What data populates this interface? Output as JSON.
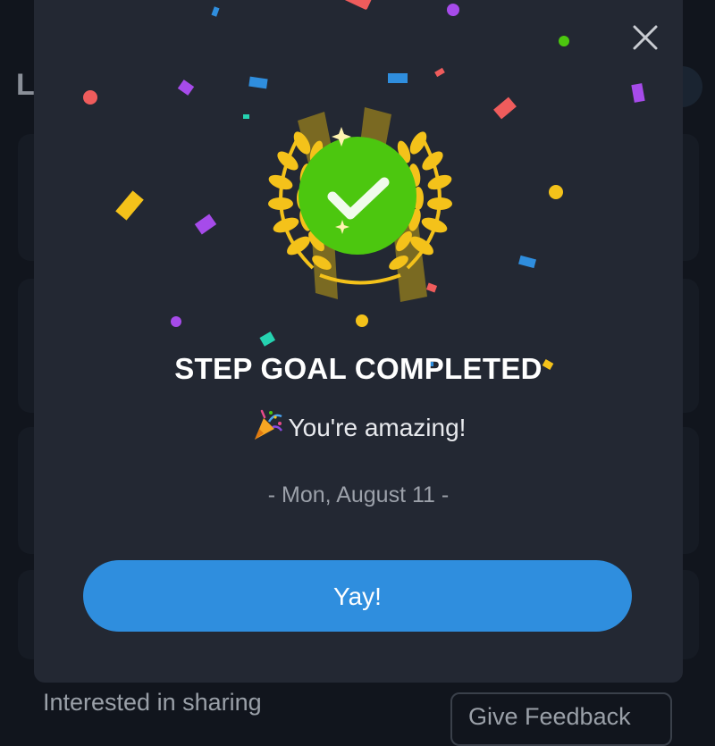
{
  "background": {
    "heading_initial": "L",
    "footer_text": "Interested in sharing",
    "feedback_button": "Give Feedback"
  },
  "modal": {
    "title": "STEP GOAL COMPLETED",
    "subtitle": "You're amazing!",
    "date": "- Mon, August 11 -",
    "confirm_button": "Yay!",
    "close_icon": "close-icon",
    "badge_icon": "check-laurel-icon",
    "party_icon": "party-popper-icon"
  },
  "colors": {
    "modal_bg": "#232833",
    "page_bg": "#11151d",
    "accent_blue": "#2f8ede",
    "success_green": "#4cc70f",
    "laurel_gold": "#f4c21a"
  }
}
